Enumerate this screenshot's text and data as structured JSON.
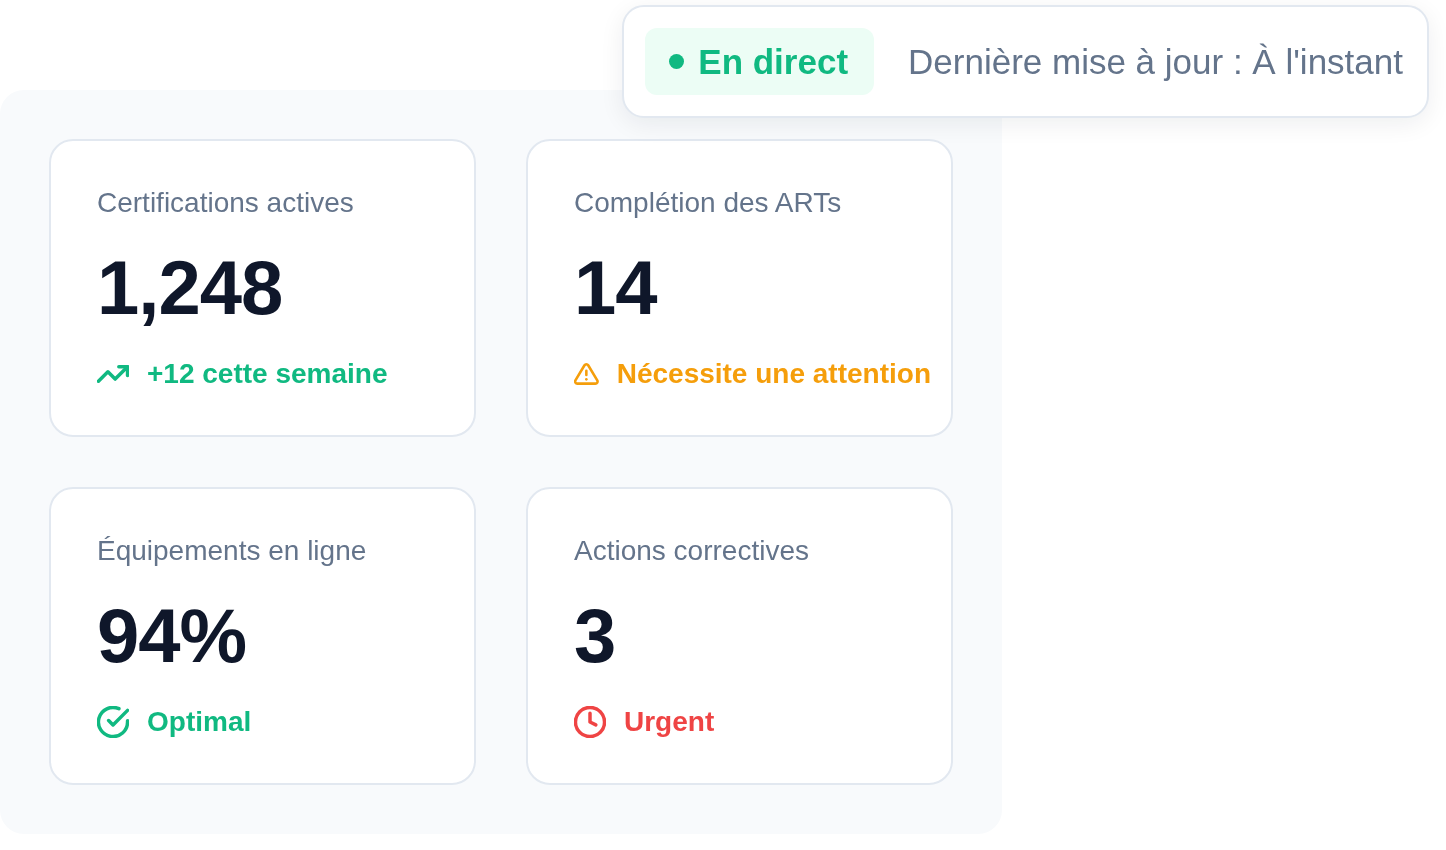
{
  "header": {
    "live_indicator": {
      "label": "En direct"
    },
    "last_updated": "Dernière mise à jour : À l'instant"
  },
  "metrics": [
    {
      "label": "Certifications actives",
      "value": "1,248",
      "status": {
        "kind": "trend",
        "text": "+12 cette semaine",
        "color": "#10b981"
      }
    },
    {
      "label": "Complétion des ARTs",
      "value": "14",
      "status": {
        "kind": "warning",
        "text": "Nécessite une attention",
        "color": "#f59e0b"
      }
    },
    {
      "label": "Équipements en ligne",
      "value": "94%",
      "status": {
        "kind": "check",
        "text": "Optimal",
        "color": "#10b981"
      }
    },
    {
      "label": "Actions correctives",
      "value": "3",
      "status": {
        "kind": "clock",
        "text": "Urgent",
        "color": "#ef4444"
      }
    }
  ]
}
